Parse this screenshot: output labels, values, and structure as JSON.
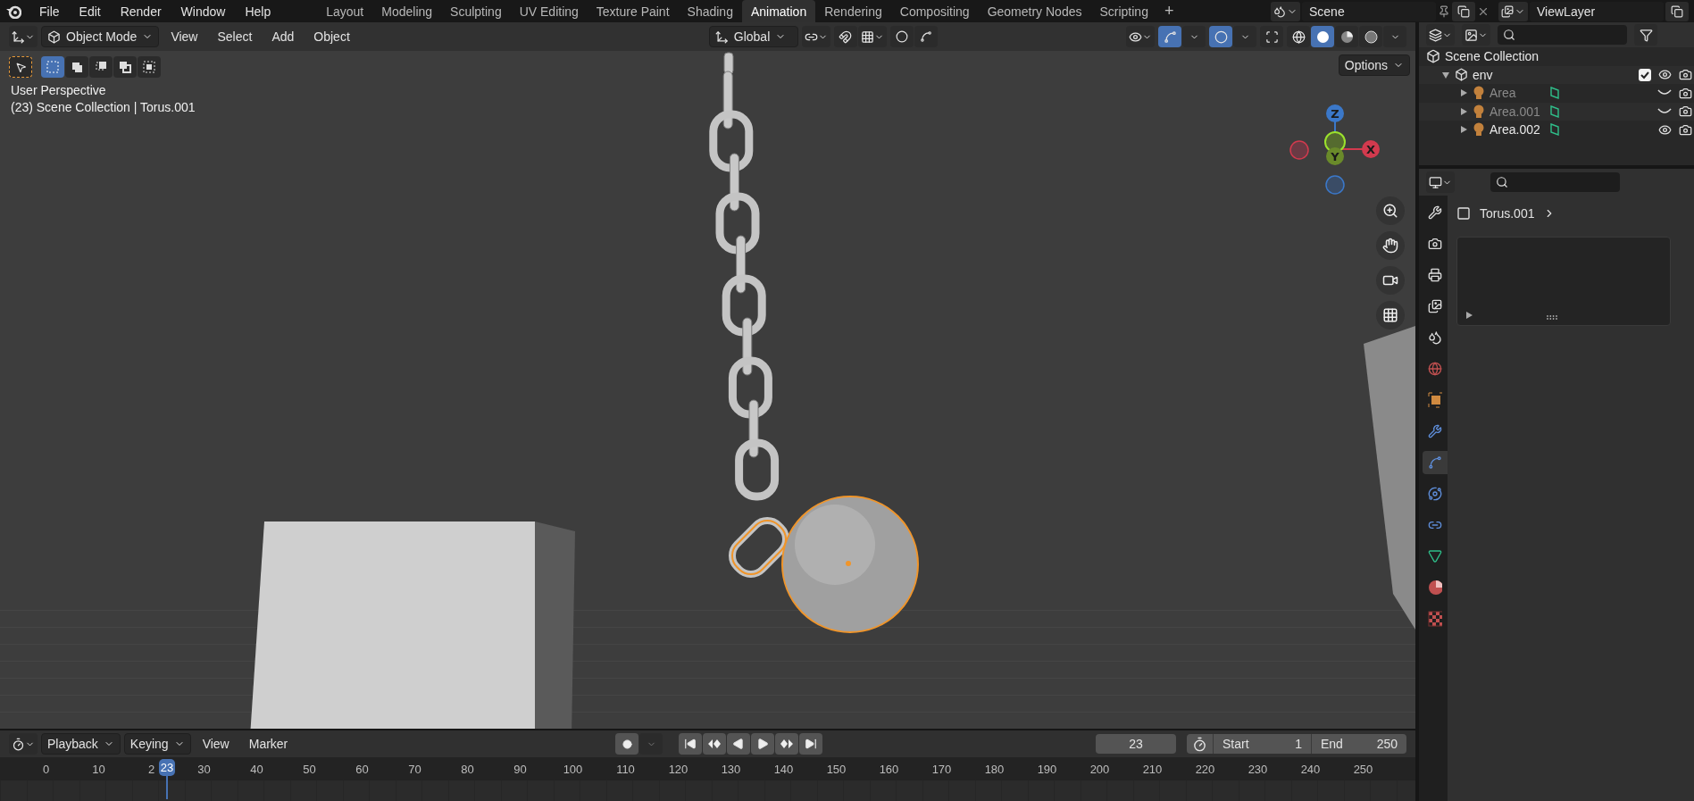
{
  "top_menu": [
    "File",
    "Edit",
    "Render",
    "Window",
    "Help"
  ],
  "workspace_tabs": [
    {
      "label": "Layout",
      "selected": false
    },
    {
      "label": "Modeling",
      "selected": false
    },
    {
      "label": "Sculpting",
      "selected": false
    },
    {
      "label": "UV Editing",
      "selected": false
    },
    {
      "label": "Texture Paint",
      "selected": false
    },
    {
      "label": "Shading",
      "selected": false
    },
    {
      "label": "Animation",
      "selected": true
    },
    {
      "label": "Rendering",
      "selected": false
    },
    {
      "label": "Compositing",
      "selected": false
    },
    {
      "label": "Geometry Nodes",
      "selected": false
    },
    {
      "label": "Scripting",
      "selected": false
    }
  ],
  "add_workspace": "+",
  "scene": "Scene",
  "view_layer": "ViewLayer",
  "viewport": {
    "mode": "Object Mode",
    "menus": [
      "View",
      "Select",
      "Add",
      "Object"
    ],
    "orientation": "Global",
    "select_modes": [
      {
        "kind": "set",
        "selected": true
      },
      {
        "kind": "extend",
        "selected": false
      },
      {
        "kind": "subtract",
        "selected": false
      },
      {
        "kind": "invert",
        "selected": false
      },
      {
        "kind": "intersect",
        "selected": false
      }
    ],
    "shading": [
      {
        "kind": "wireframe",
        "selected": false
      },
      {
        "kind": "solid",
        "selected": true
      },
      {
        "kind": "material",
        "selected": false
      },
      {
        "kind": "rendered",
        "selected": false
      }
    ],
    "options": "Options",
    "info": [
      "User Perspective",
      "(23) Scene Collection | Torus.001"
    ],
    "gizmo_axes": [
      {
        "kind": "z",
        "label": "Z"
      },
      {
        "kind": "x",
        "label": "X"
      },
      {
        "kind": "y",
        "label": "Y"
      }
    ]
  },
  "outliner": {
    "root": "Scene Collection",
    "collections": [
      {
        "label": "env",
        "expanded": true,
        "checked": true,
        "children": [
          {
            "label": "Area",
            "hidden": true
          },
          {
            "label": "Area.001",
            "hidden": true
          },
          {
            "label": "Area.002",
            "hidden": false
          }
        ]
      }
    ]
  },
  "properties": {
    "object": "Torus.001",
    "tabs": [
      {
        "kind": "tool",
        "selected": false
      },
      {
        "kind": "render",
        "selected": false
      },
      {
        "kind": "output",
        "selected": false
      },
      {
        "kind": "view_layer",
        "selected": false
      },
      {
        "kind": "scene",
        "selected": false
      },
      {
        "kind": "world",
        "selected": false
      },
      {
        "kind": "object",
        "selected": false
      },
      {
        "kind": "modifiers",
        "selected": false
      },
      {
        "kind": "particles",
        "selected": true
      },
      {
        "kind": "physics",
        "selected": false
      },
      {
        "kind": "constraints",
        "selected": false
      },
      {
        "kind": "data",
        "selected": false
      },
      {
        "kind": "material",
        "selected": false
      },
      {
        "kind": "texture",
        "selected": false
      }
    ]
  },
  "timeline": {
    "menus": [
      {
        "label": "Playback",
        "kind": "dropdown"
      },
      {
        "label": "Keying",
        "kind": "dropdown"
      },
      {
        "label": "View",
        "kind": "menu"
      },
      {
        "label": "Marker",
        "kind": "menu"
      }
    ],
    "current_frame": "23",
    "start_label": "Start",
    "start": "1",
    "end_label": "End",
    "end": "250",
    "ticks": [
      "0",
      "10",
      "2",
      "30",
      "40",
      "50",
      "60",
      "70",
      "80",
      "90",
      "100",
      "110",
      "120",
      "130",
      "140",
      "150",
      "160",
      "170",
      "180",
      "190",
      "200",
      "210",
      "220",
      "230",
      "240",
      "250"
    ],
    "playhead": {
      "label": "23"
    }
  }
}
